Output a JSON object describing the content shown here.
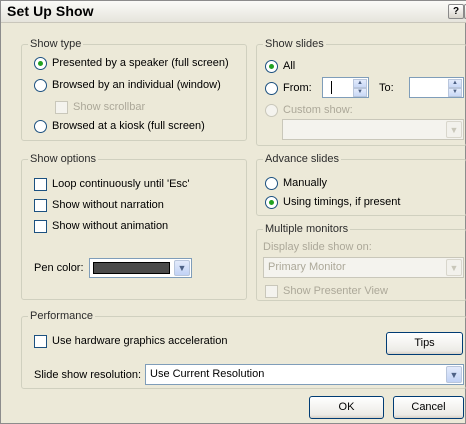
{
  "title": "Set Up Show",
  "colors": {
    "pen_color": "#4a4a4a",
    "face": "#ece9d8",
    "disabled_text": "#aca899"
  },
  "show_type": {
    "label": "Show type",
    "speaker": "Presented by a speaker (full screen)",
    "individual": "Browsed by an individual (window)",
    "scrollbar": "Show scrollbar",
    "kiosk": "Browsed at a kiosk (full screen)"
  },
  "show_slides": {
    "label": "Show slides",
    "all": "All",
    "from": "From:",
    "to": "To:",
    "custom": "Custom show:"
  },
  "show_options": {
    "label": "Show options",
    "loop": "Loop continuously until 'Esc'",
    "no_narration": "Show without narration",
    "no_animation": "Show without animation",
    "pen_color": "Pen color:"
  },
  "advance": {
    "label": "Advance slides",
    "manually": "Manually",
    "timings": "Using timings, if present"
  },
  "monitors": {
    "label": "Multiple monitors",
    "display_on": "Display slide show on:",
    "monitor_value": "Primary Monitor",
    "presenter_view": "Show Presenter View"
  },
  "performance": {
    "label": "Performance",
    "hw_accel": "Use hardware graphics acceleration",
    "tips": "Tips",
    "resolution_label": "Slide show resolution:",
    "resolution_value": "Use Current Resolution"
  },
  "buttons": {
    "ok": "OK",
    "cancel": "Cancel"
  }
}
